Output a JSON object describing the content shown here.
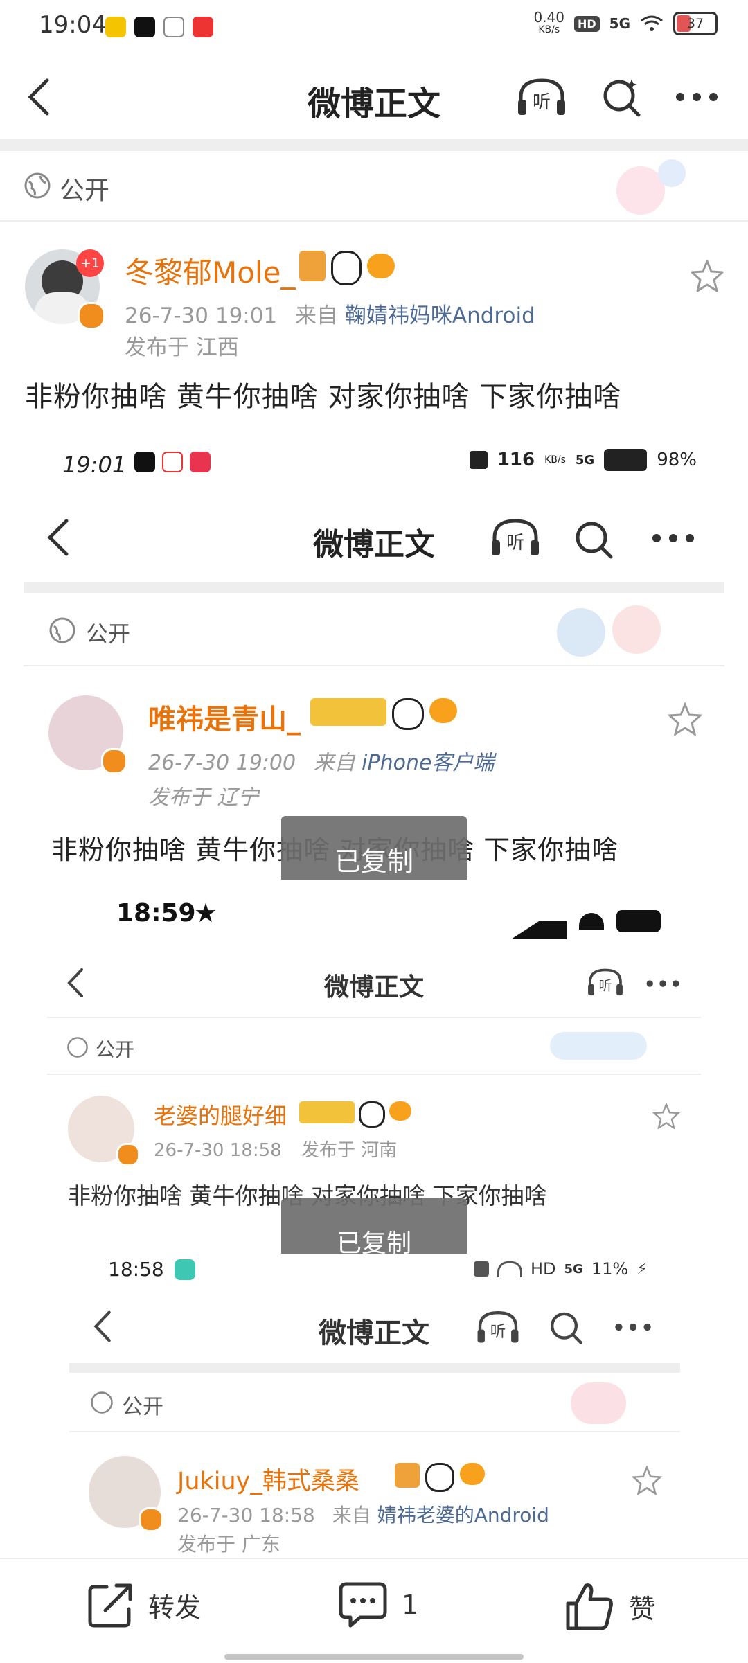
{
  "status_bar": {
    "time": "19:04",
    "net_speed_top": "0.40",
    "net_speed_unit": "KB/s",
    "hd": "HD",
    "signal": "5G",
    "battery": "37"
  },
  "nav": {
    "title": "微博正文",
    "listen_label": "听"
  },
  "visibility": "公开",
  "post": {
    "username": "冬黎郁Mole_",
    "avatar_badge": "+1",
    "time": "26-7-30 19:01",
    "source_prefix": "来自",
    "source": "鞠婧祎妈咪Android",
    "region": "发布于 江西",
    "text": "非粉你抽啥  黄牛你抽啥  对家你抽啥  下家你抽啥"
  },
  "embedded_1": {
    "status_time": "19:01",
    "net_speed": "116",
    "net_unit": "KB/s",
    "signal": "5G",
    "battery": "98%",
    "title": "微博正文",
    "listen_label": "听",
    "visibility": "公开",
    "username": "唯祎是青山_",
    "time": "26-7-30 19:00",
    "source_prefix": "来自",
    "source": "iPhone客户端",
    "region": "发布于 辽宁",
    "text": "非粉你抽啥  黄牛你抽啥  对家你抽啥  下家你抽啥",
    "toast": "已复制"
  },
  "embedded_2": {
    "status_time": "18:59",
    "title": "微博正文",
    "listen_label": "听",
    "visibility": "公开",
    "username": "老婆的腿好细",
    "time": "26-7-30 18:58",
    "region": "发布于 河南",
    "text": "非粉你抽啥  黄牛你抽啥  对家你抽啥  下家你抽啥",
    "toast": "已复制"
  },
  "embedded_3": {
    "status_time": "18:58",
    "hd": "HD",
    "signal": "5G",
    "battery": "11%",
    "title": "微博正文",
    "listen_label": "听",
    "visibility": "公开",
    "username": "Jukiuy_韩式桑桑",
    "time": "26-7-30 18:58",
    "source_prefix": "来自",
    "source": "婧祎老婆的Android",
    "region": "发布于 广东"
  },
  "bottom_bar": {
    "forward": "转发",
    "comment_count": "1",
    "like": "赞"
  },
  "colors": {
    "accent_orange": "#e8730b",
    "source_blue": "#4d6a94",
    "verified": "#f18d1c"
  }
}
